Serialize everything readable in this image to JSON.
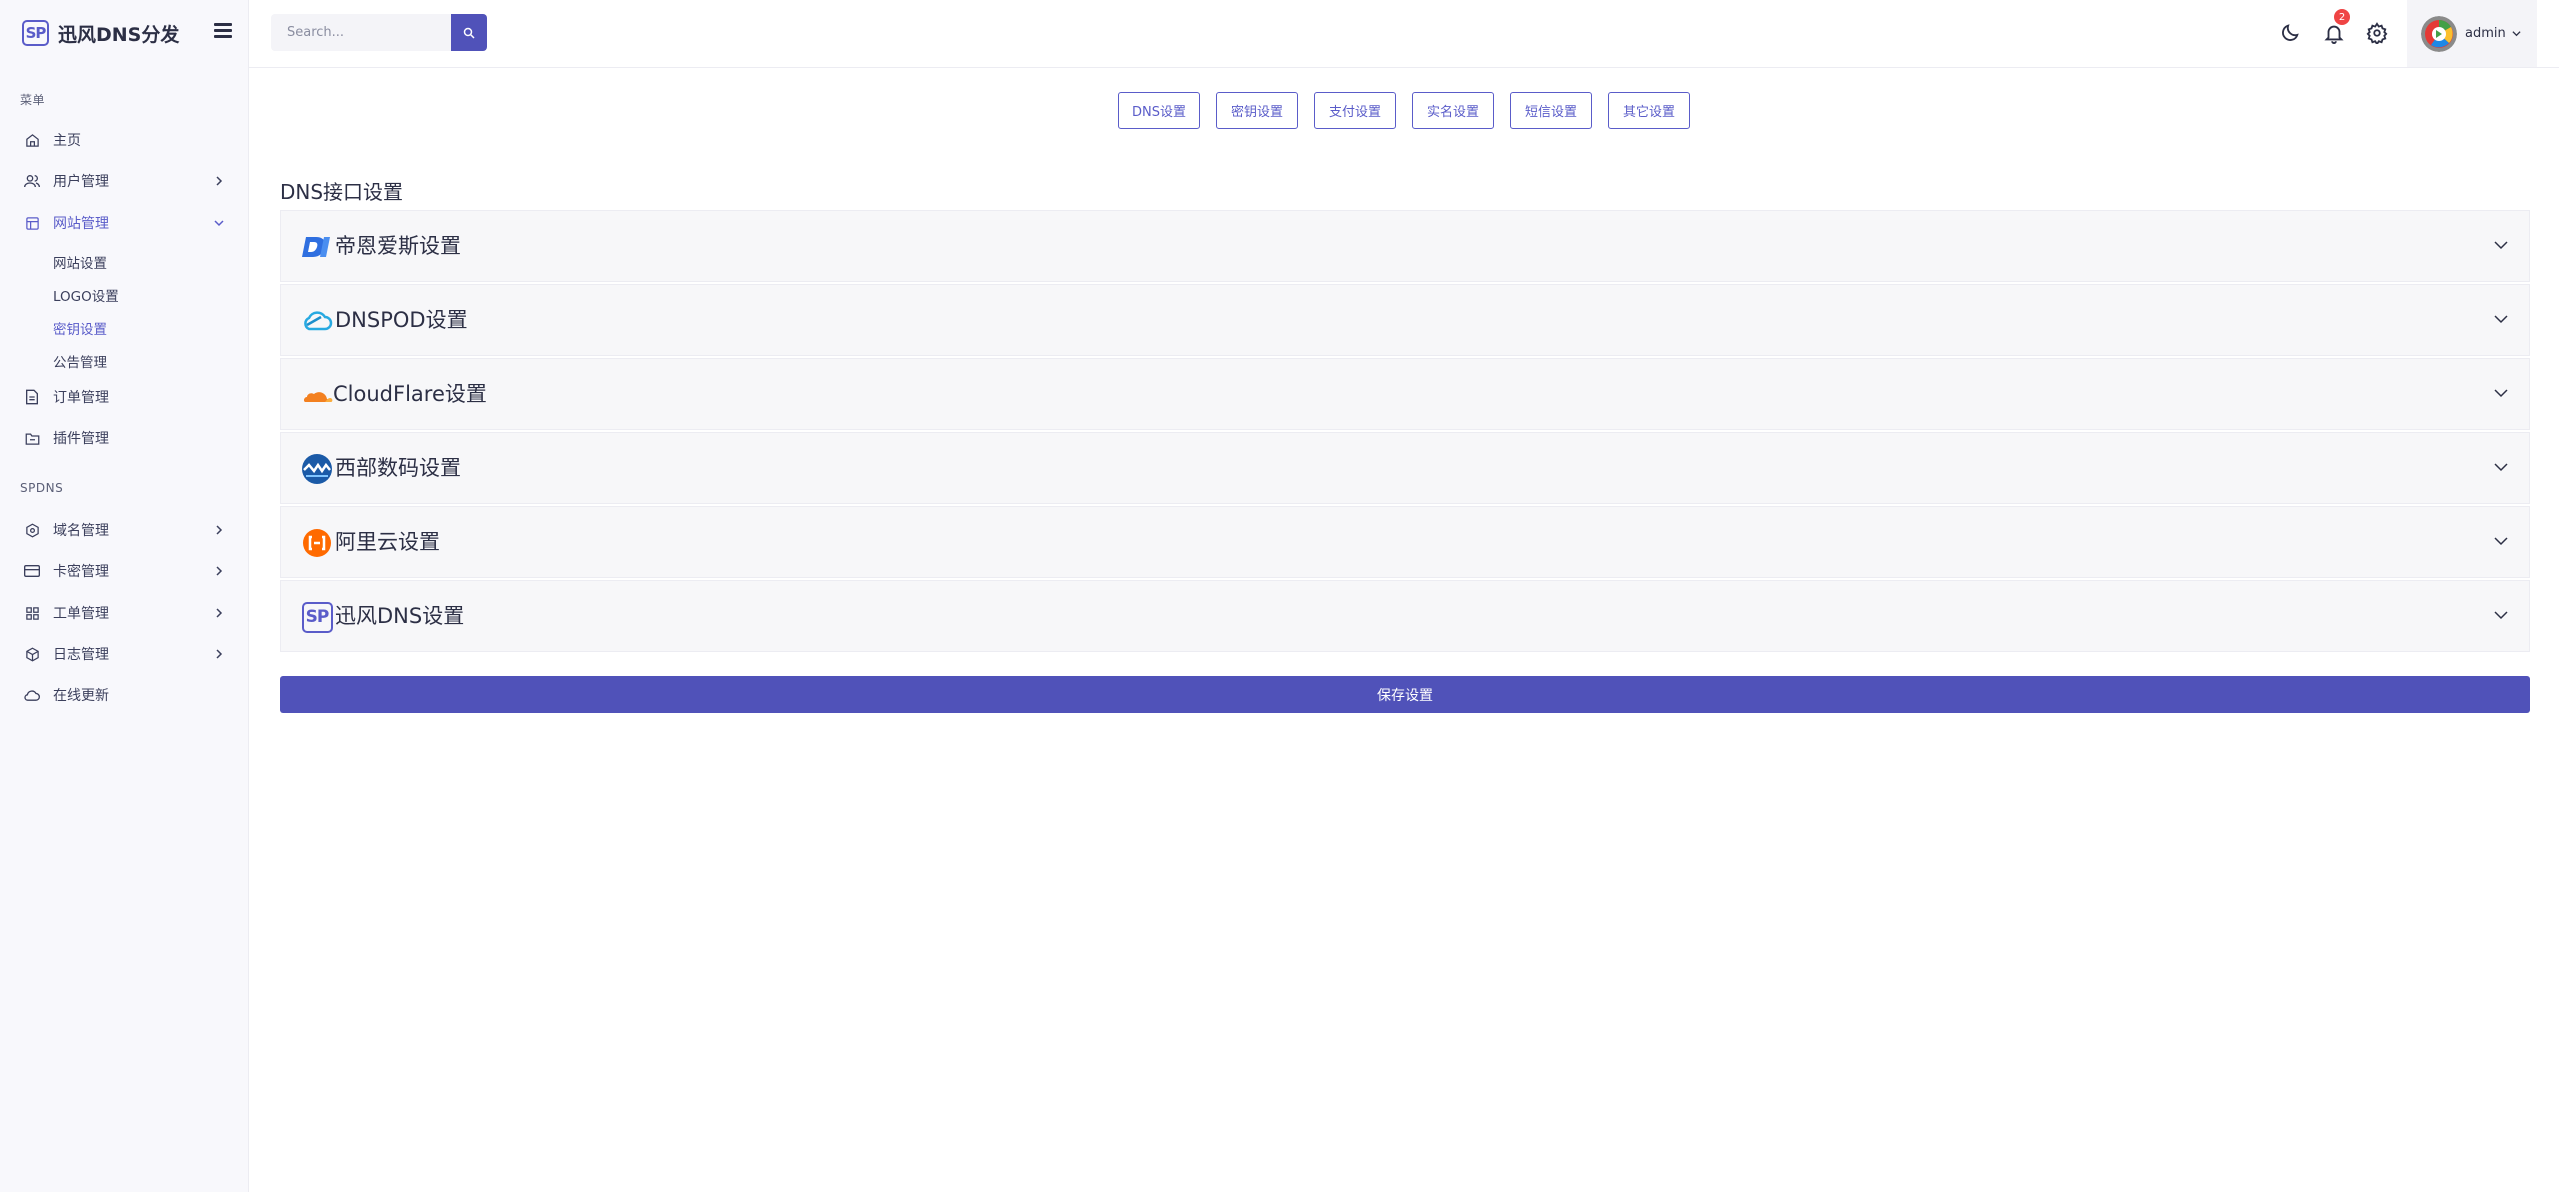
{
  "brand": {
    "logo_text": "SP",
    "name": "迅风DNS分发"
  },
  "search": {
    "placeholder": "Search..."
  },
  "notifications": {
    "count": "2"
  },
  "user": {
    "name": "admin"
  },
  "sidebar": {
    "section1": "菜单",
    "section2": "SPDNS",
    "items": [
      {
        "label": "主页",
        "icon": "home-icon"
      },
      {
        "label": "用户管理",
        "icon": "users-icon"
      },
      {
        "label": "网站管理",
        "icon": "layout-icon"
      },
      {
        "label": "订单管理",
        "icon": "file-icon"
      },
      {
        "label": "插件管理",
        "icon": "folder-icon"
      },
      {
        "label": "域名管理",
        "icon": "hexagon-icon"
      },
      {
        "label": "卡密管理",
        "icon": "card-icon"
      },
      {
        "label": "工单管理",
        "icon": "grid-icon"
      },
      {
        "label": "日志管理",
        "icon": "box-icon"
      },
      {
        "label": "在线更新",
        "icon": "cloud-icon"
      }
    ],
    "website_sub": [
      "网站设置",
      "LOGO设置",
      "密钥设置",
      "公告管理"
    ]
  },
  "tabs": [
    "DNS设置",
    "密钥设置",
    "支付设置",
    "实名设置",
    "短信设置",
    "其它设置"
  ],
  "main": {
    "section_title": "DNS接口设置",
    "providers": [
      {
        "label": "帝恩爱斯设置",
        "icon": "dns-la-icon",
        "color": "#2f6fe0"
      },
      {
        "label": "DNSPOD设置",
        "icon": "dnspod-cloud-icon",
        "color": "#27a9e1"
      },
      {
        "label": "CloudFlare设置",
        "icon": "cloudflare-icon",
        "color": "#f38020"
      },
      {
        "label": "西部数码设置",
        "icon": "west-digital-icon",
        "color": "#1b5aa7"
      },
      {
        "label": "阿里云设置",
        "icon": "aliyun-icon",
        "color": "#ff6a00"
      },
      {
        "label": "迅风DNS设置",
        "icon": "sp-logo-icon",
        "color": "#5a5cc9",
        "logo_text": "SP"
      }
    ],
    "save_label": "保存设置"
  },
  "colors": {
    "accent": "#5052b9",
    "badge": "#ef4444"
  }
}
